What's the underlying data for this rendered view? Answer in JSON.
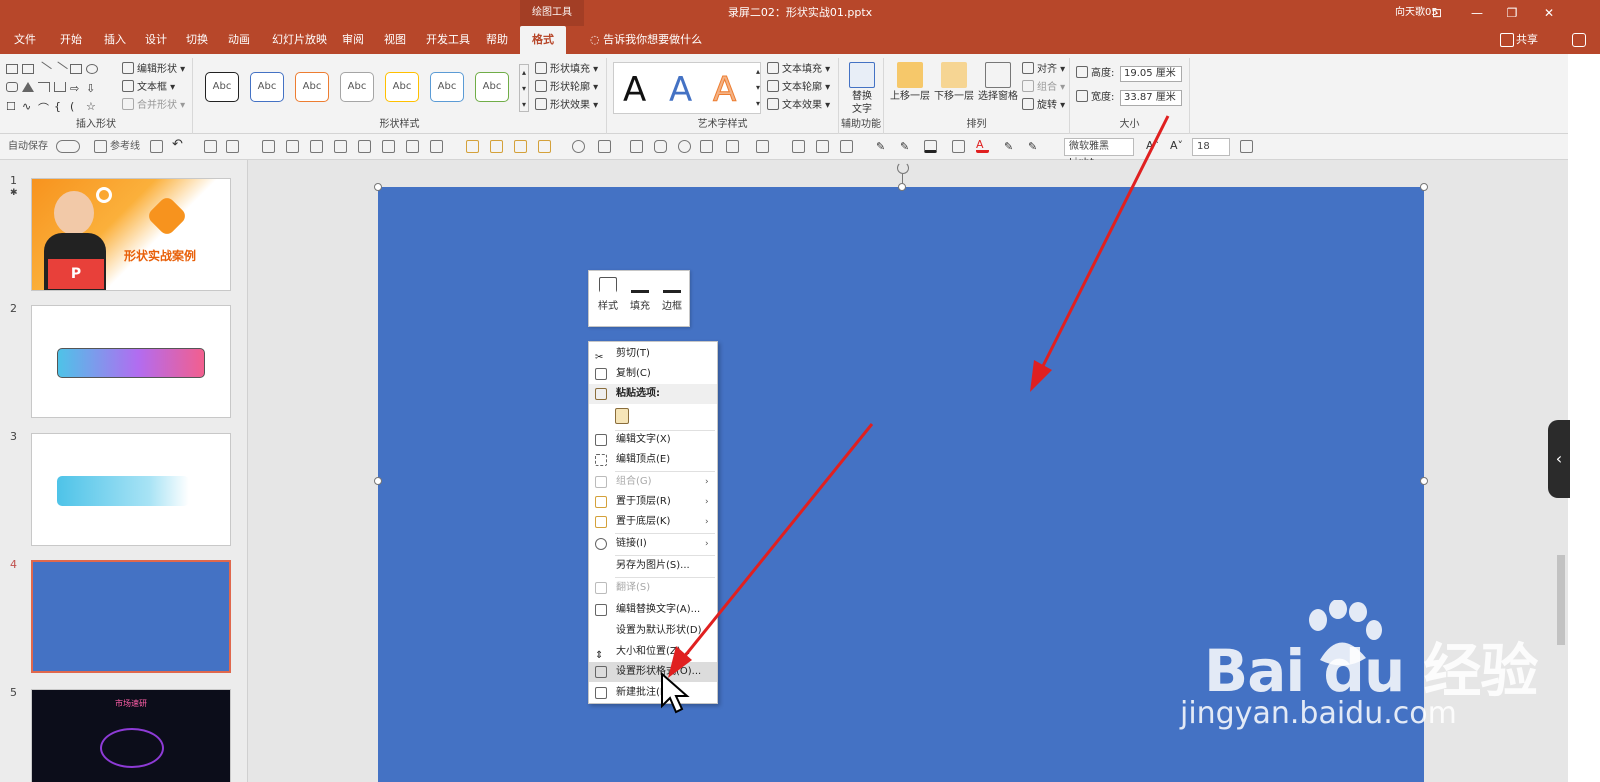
{
  "titlebar": {
    "context_tab": "绘图工具",
    "doc_title": "录屏二02：形状实战01.pptx",
    "user": "向天歌05",
    "min_glyph": "—",
    "max_glyph": "❐",
    "close_glyph": "✕"
  },
  "tabs": [
    "文件",
    "开始",
    "插入",
    "设计",
    "切换",
    "动画",
    "幻灯片放映",
    "审阅",
    "视图",
    "开发工具",
    "帮助",
    "格式"
  ],
  "tellme": "告诉我你想要做什么",
  "share": "共享",
  "ribbon": {
    "insert_shapes": {
      "label": "插入形状",
      "edit_shape": "编辑形状",
      "text_box": "文本框",
      "merge_shapes": "合并形状"
    },
    "shape_styles": {
      "label": "形状样式",
      "abc": [
        "Abc",
        "Abc",
        "Abc",
        "Abc",
        "Abc",
        "Abc",
        "Abc"
      ],
      "fill": "形状填充",
      "outline": "形状轮廓",
      "effects": "形状效果"
    },
    "art_text": {
      "label": "艺术字样式",
      "a_glyph": "A",
      "text_fill": "文本填充",
      "text_outline": "文本轮廓",
      "text_effects": "文本效果"
    },
    "accessibility": {
      "label": "辅助功能",
      "alt_text": "替换文字"
    },
    "arrange": {
      "label": "排列",
      "bring_forward": "上移一层",
      "send_backward": "下移一层",
      "selection_pane": "选择窗格",
      "align": "对齐",
      "group": "组合",
      "rotate": "旋转"
    },
    "size": {
      "label": "大小",
      "height_label": "高度:",
      "height_value": "19.05 厘米",
      "width_label": "宽度:",
      "width_value": "33.87 厘米"
    }
  },
  "qat": {
    "autosave": "自动保存",
    "guides": "参考线",
    "font_name": "微软雅黑 Light",
    "font_size": "18"
  },
  "slides": [
    {
      "number": "1",
      "title": "形状实战案例",
      "sign": "P"
    },
    {
      "number": "2"
    },
    {
      "number": "3"
    },
    {
      "number": "4"
    },
    {
      "number": "5",
      "text": "市场速研"
    }
  ],
  "mini_toolbar": {
    "style": "样式",
    "fill": "填充",
    "outline": "边框"
  },
  "context_menu": [
    {
      "label": "剪切(T)"
    },
    {
      "label": "复制(C)"
    },
    {
      "label": "粘贴选项:"
    },
    {
      "label": "编辑文字(X)"
    },
    {
      "label": "编辑顶点(E)"
    },
    {
      "label": "组合(G)"
    },
    {
      "label": "置于顶层(R)"
    },
    {
      "label": "置于底层(K)"
    },
    {
      "label": "链接(I)"
    },
    {
      "label": "另存为图片(S)..."
    },
    {
      "label": "翻译(S)"
    },
    {
      "label": "编辑替换文字(A)..."
    },
    {
      "label": "设置为默认形状(D)"
    },
    {
      "label": "大小和位置(Z)..."
    },
    {
      "label": "设置形状格式(O)..."
    },
    {
      "label": "新建批注(M)"
    }
  ],
  "watermark": {
    "brand": "Bai du 经验",
    "url": "jingyan.baidu.com"
  },
  "colors": {
    "accent": "#b7472a",
    "slide_fill": "#4472c4",
    "arrow": "#e02020"
  }
}
